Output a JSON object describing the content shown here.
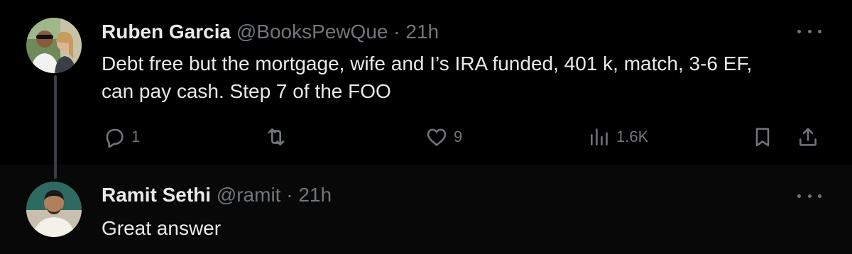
{
  "tweets": [
    {
      "author_name": "Ruben Garcia",
      "handle": "@BooksPewQue",
      "separator": "·",
      "time": "21h",
      "text_lines": [
        "Debt free but the mortgage, wife and I’s IRA funded, 401 k, match, 3-6 EF,",
        "can pay cash. Step 7 of the FOO"
      ],
      "actions": {
        "replies": "1",
        "likes": "9",
        "views": "1.6K"
      }
    },
    {
      "author_name": "Ramit Sethi",
      "handle": "@ramit",
      "separator": "·",
      "time": "21h",
      "text": "Great answer"
    }
  ],
  "icons": {
    "reply": "reply-icon",
    "retweet": "retweet-icon",
    "like": "heart-icon",
    "views": "views-icon",
    "bookmark": "bookmark-icon",
    "share": "share-icon",
    "more": "more-icon"
  },
  "colors": {
    "background": "#000000",
    "reply_background": "#080808",
    "text_primary": "#e7e9ea",
    "text_secondary": "#71767b",
    "thread_line": "#3b3f44"
  }
}
